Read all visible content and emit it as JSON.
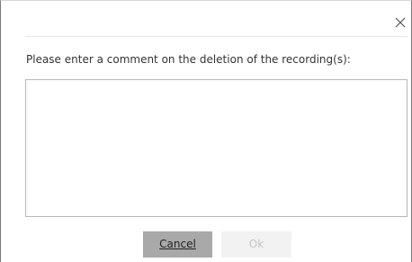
{
  "dialog": {
    "close_icon": "close-icon",
    "prompt": "Please enter a comment on the deletion of the recording(s):",
    "comment": {
      "value": "",
      "placeholder": ""
    },
    "buttons": {
      "cancel_label": "Cancel",
      "ok_label": "Ok"
    }
  },
  "colors": {
    "cancel_button_bg": "#a9a9a9",
    "ok_button_bg_disabled": "#f2f2f2",
    "ok_button_text_disabled": "#c4c4c4",
    "border": "#7a7a7a"
  }
}
